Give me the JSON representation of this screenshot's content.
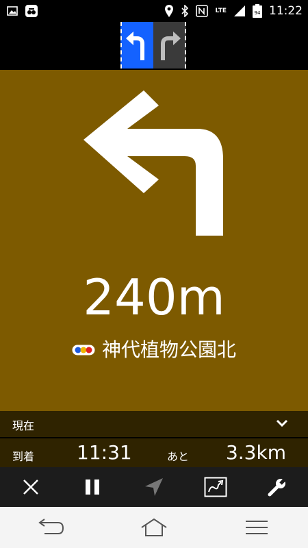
{
  "status_bar": {
    "time": "11:22",
    "network_type": "LTE",
    "battery_level": "94",
    "icons": [
      "image-icon",
      "app-notification-icon",
      "location-icon",
      "bluetooth-icon",
      "nfc-icon",
      "signal-icon",
      "battery-icon"
    ]
  },
  "lane_guidance": {
    "lanes": [
      {
        "direction": "left",
        "active": true,
        "color": "#1462ff"
      },
      {
        "direction": "right",
        "active": false,
        "color": "#3a3a3a"
      }
    ]
  },
  "guidance": {
    "panel_color": "#7d5a00",
    "turn_direction": "left",
    "distance": "240m",
    "street_name": "神代植物公園北"
  },
  "info": {
    "current_label": "現在",
    "arrival_label": "到着",
    "eta": "11:31",
    "remaining_label": "あと",
    "remaining_distance": "3.3km"
  },
  "toolbar": {
    "buttons": [
      "close-icon",
      "pause-icon",
      "navigation-icon",
      "route-icon",
      "wrench-icon"
    ]
  },
  "system_nav": {
    "buttons": [
      "back-icon",
      "home-icon",
      "menu-icon"
    ]
  }
}
